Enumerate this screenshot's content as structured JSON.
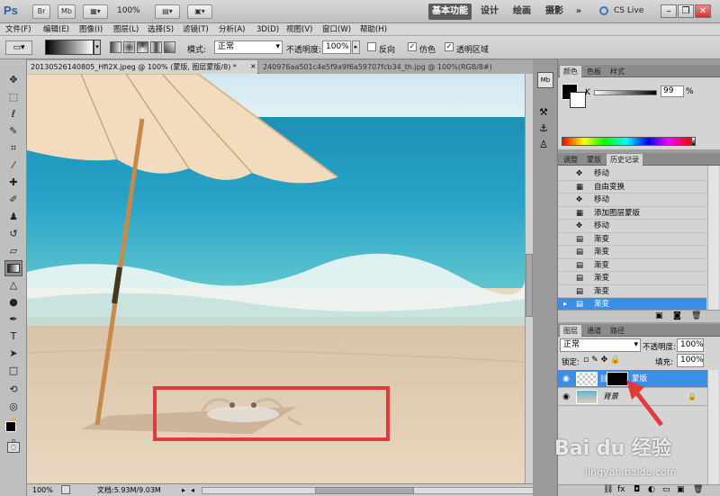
{
  "app": {
    "logo": "Ps",
    "bridge_button": "Br",
    "minibridge_button": "Mb",
    "zoom": "100%"
  },
  "workspaces": {
    "essentials": "基本功能",
    "design": "设计",
    "painting": "绘画",
    "photography": "摄影",
    "more": "»",
    "cs_live": "CS Live"
  },
  "menu": [
    "文件(F)",
    "编辑(E)",
    "图像(I)",
    "图层(L)",
    "选择(S)",
    "滤镜(T)",
    "分析(A)",
    "3D(D)",
    "视图(V)",
    "窗口(W)",
    "帮助(H)"
  ],
  "options": {
    "mode_label": "模式:",
    "mode_value": "正常",
    "opacity_label": "不透明度:",
    "opacity_value": "100%",
    "reverse_label": "反向",
    "dither_label": "仿色",
    "transparency_label": "透明区域",
    "reverse_checked": false,
    "dither_checked": true,
    "transparency_checked": true
  },
  "doc_tabs": [
    {
      "label": "20130526140805_Hfi2X.jpeg @ 100% (蒙版, 图层蒙版/8) *",
      "active": true
    },
    {
      "label": "240976aa501c4e5f9a9f6a59707fcb34_th.jpg @ 100%(RGB/8#)",
      "active": false
    }
  ],
  "status": {
    "zoom": "100%",
    "doc_size": "文档:5.93M/9.03M"
  },
  "color_panel": {
    "tabs": [
      "颜色",
      "色板",
      "样式"
    ],
    "channel": "K",
    "value": "99",
    "unit": "%"
  },
  "history_panel": {
    "tabs": [
      "调整",
      "蒙版",
      "历史记录"
    ],
    "items": [
      "移动",
      "自由变换",
      "移动",
      "添加图层蒙版",
      "移动",
      "渐变",
      "渐变",
      "渐变",
      "渐变",
      "渐变",
      "渐变"
    ],
    "selected_index": 10
  },
  "layers_panel": {
    "tabs": [
      "图层",
      "通道",
      "路径"
    ],
    "blend_mode": "正常",
    "opacity_label": "不透明度:",
    "opacity_value": "100%",
    "lock_label": "锁定:",
    "fill_label": "填充:",
    "fill_value": "100%",
    "layers": [
      {
        "name": "蒙版",
        "selected": true
      },
      {
        "name": "背景",
        "selected": false
      }
    ]
  },
  "watermark": {
    "brand": "Bai du 经验",
    "url": "jingyan.baidu.com"
  },
  "colors": {
    "selection_blue": "#3a8ee6",
    "annotation_red": "#e03a3a"
  }
}
